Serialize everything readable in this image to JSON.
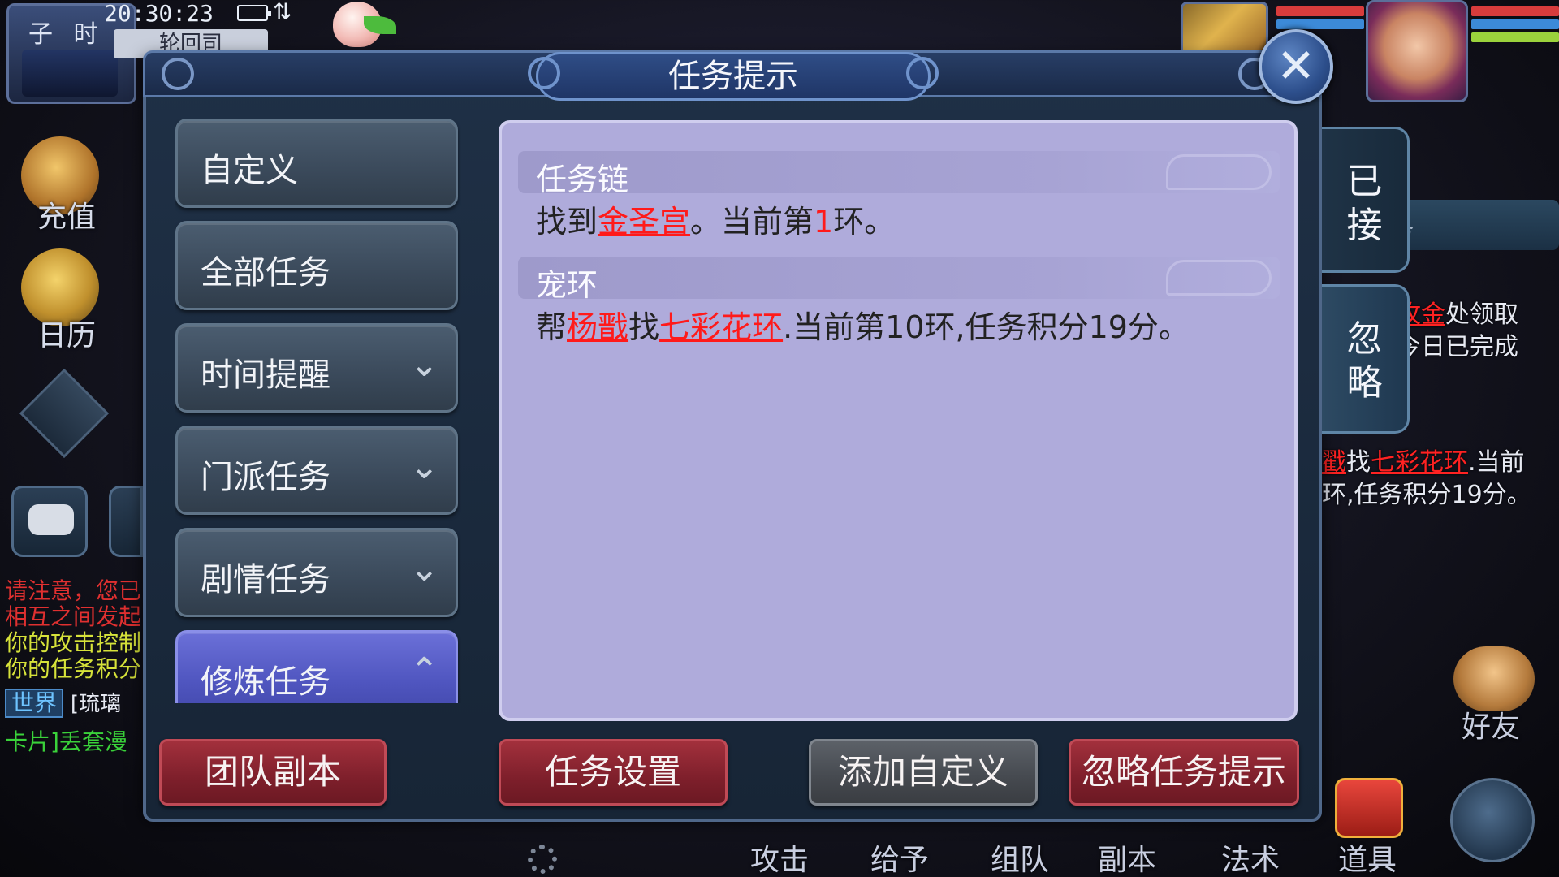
{
  "hud": {
    "shichen": "子 时",
    "time": "20:30:23",
    "signal_glyph": "⇅",
    "map_name": "轮回司",
    "left_icons": [
      {
        "label": "充值",
        "icon": "treasure-chest-icon"
      },
      {
        "label": "日历",
        "icon": "calendar-gong-icon"
      }
    ],
    "chat_lines": [
      {
        "text": "请注意，您已",
        "color": "#e03030"
      },
      {
        "text": "相互之间发起",
        "color": "#e03030"
      },
      {
        "text": "你的攻击控制",
        "color": "#d6e23a"
      },
      {
        "text": "你的任务积分",
        "color": "#d6e23a"
      }
    ],
    "chat_channel": "世界",
    "chat_channel_msg": "[琉璃",
    "chat_last": "卡片]丢套漫",
    "right_tip_1_red": "攻金",
    "right_tip_1_rest": "处领取",
    "right_tip_2": "今日已完成",
    "right_tip_3_red": "戳",
    "right_tip_3_mid": "找",
    "right_tip_3_red2": "七彩花环",
    "right_tip_3_rest": ".当前",
    "right_tip_4": "环,任务积分19分。",
    "right_side_char": "务",
    "friend_label": "好友",
    "bottom_actions": [
      "攻击",
      "给予",
      "组队",
      "副本",
      "法术",
      "道具"
    ]
  },
  "dialog": {
    "title": "任务提示",
    "close_glyph": "✕",
    "categories": [
      {
        "label": "自定义",
        "chevron": ""
      },
      {
        "label": "全部任务",
        "chevron": ""
      },
      {
        "label": "时间提醒",
        "chevron": "⌄"
      },
      {
        "label": "门派任务",
        "chevron": "⌄"
      },
      {
        "label": "剧情任务",
        "chevron": "⌄"
      },
      {
        "label": "修炼任务",
        "chevron": "⌃"
      }
    ],
    "active_category": "修炼任务",
    "tasks": [
      {
        "title": "任务链",
        "desc_prefix": "找到",
        "desc_link": "金圣宫",
        "desc_mid": "。当前第",
        "desc_num": "1",
        "desc_suffix": "环。"
      },
      {
        "title": "宠环",
        "desc_prefix": "帮",
        "desc_link": "杨戬",
        "desc_mid": "找",
        "desc_link2": "七彩花环",
        "desc_suffix": ".当前第10环,任务积分19分。"
      }
    ],
    "side_tabs": [
      {
        "chars": [
          "已",
          "接"
        ]
      },
      {
        "chars": [
          "忽",
          "略"
        ]
      }
    ],
    "buttons": {
      "team_dungeon": "团队副本",
      "task_settings": "任务设置",
      "add_custom": "添加自定义",
      "ignore_tips": "忽略任务提示"
    }
  },
  "colors": {
    "content_bg": "#afabdb",
    "active_tab": "#5a60c8",
    "red_button": "#8a2430",
    "link_red": "#ff1a1a"
  }
}
